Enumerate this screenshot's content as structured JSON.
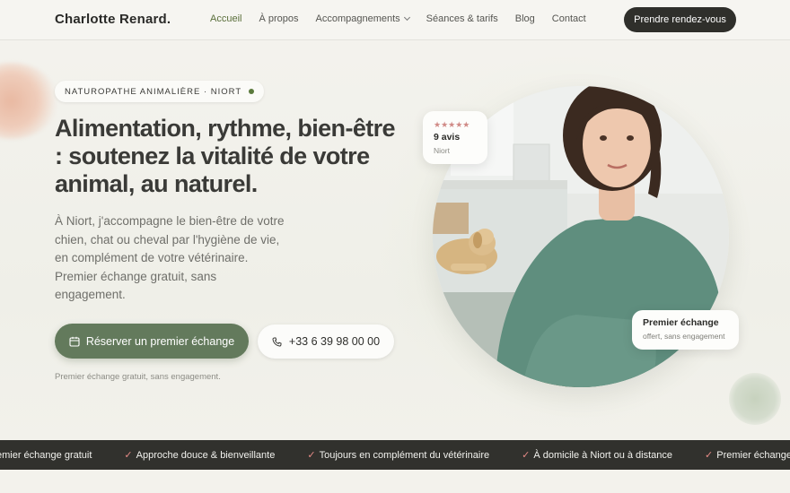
{
  "header": {
    "logo": "Charlotte Renard.",
    "nav": [
      {
        "label": "Accueil",
        "active": true
      },
      {
        "label": "À propos"
      },
      {
        "label": "Accompagnements",
        "dropdown": true
      },
      {
        "label": "Séances & tarifs"
      },
      {
        "label": "Blog"
      },
      {
        "label": "Contact"
      }
    ],
    "cta": "Prendre rendez-vous"
  },
  "hero": {
    "badge": "NATUROPATHE ANIMALIÈRE · NIORT",
    "headline": "Alimentation, rythme, bien-être : soutenez la vitalité de votre animal, au naturel.",
    "lead": "À Niort, j'accompagne le bien-être de votre chien, chat ou cheval par l'hygiène de vie, en complément de votre vétérinaire. Premier échange gratuit, sans engagement.",
    "primary_button": "Réserver un premier échange",
    "phone_button": "+33 6 39 98 00 00",
    "note": "Premier échange gratuit, sans engagement."
  },
  "review_card": {
    "stars": "★★★★★",
    "count": "9 avis",
    "place": "Niort"
  },
  "first_card": {
    "title": "Premier échange",
    "subtitle": "offert, sans engagement"
  },
  "marquee": {
    "lead_fragment": "emier échange gratuit",
    "items": [
      "Approche douce & bienveillante",
      "Toujours en complément du vétérinaire",
      "À domicile à Niort ou à distance",
      "Premier échange gratuit"
    ]
  },
  "colors": {
    "accent": "#637a5c",
    "active_nav": "#5a6e3a",
    "dark": "#2f2f2b",
    "star": "#d08a86"
  }
}
